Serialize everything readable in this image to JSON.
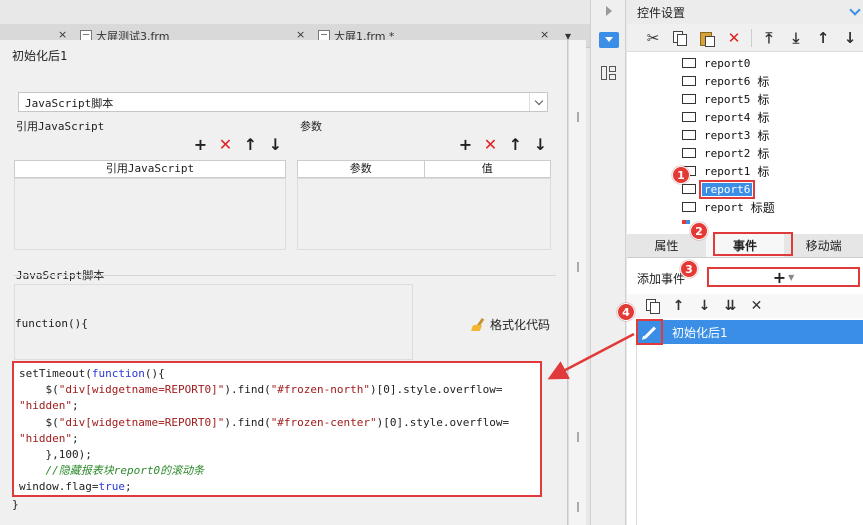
{
  "tabs": [
    {
      "label": "大屏测试3.frm",
      "close": "×"
    },
    {
      "label": "大屏1.frm *",
      "close": "×"
    }
  ],
  "dialog": {
    "title": "初始化后1",
    "script_type": "JavaScript脚本",
    "ref_js_label": "引用JavaScript",
    "params_label": "参数",
    "ref_js_col": "引用JavaScript",
    "param_col": "参数",
    "value_col": "值",
    "script_label": "JavaScript脚本",
    "fn_head": "function(){",
    "format_button": "格式化代码",
    "code_lines": [
      [
        {
          "t": "setTimeout(",
          "c": ""
        },
        {
          "t": "function",
          "c": "kw"
        },
        {
          "t": "(){",
          "c": ""
        }
      ],
      [
        {
          "t": "    $(",
          "c": ""
        },
        {
          "t": "\"div[widgetname=REPORT0]\"",
          "c": "str"
        },
        {
          "t": ").find(",
          "c": ""
        },
        {
          "t": "\"#frozen-north\"",
          "c": "str"
        },
        {
          "t": ")[0].style.overflow=",
          "c": ""
        }
      ],
      [
        {
          "t": "\"hidden\"",
          "c": "str"
        },
        {
          "t": ";",
          "c": ""
        }
      ],
      [
        {
          "t": "    $(",
          "c": ""
        },
        {
          "t": "\"div[widgetname=REPORT0]\"",
          "c": "str"
        },
        {
          "t": ").find(",
          "c": ""
        },
        {
          "t": "\"#frozen-center\"",
          "c": "str"
        },
        {
          "t": ")[0].style.overflow=",
          "c": ""
        }
      ],
      [
        {
          "t": "\"hidden\"",
          "c": "str"
        },
        {
          "t": ";",
          "c": ""
        }
      ],
      [
        {
          "t": "    },100);",
          "c": ""
        }
      ],
      [
        {
          "t": "    //隐藏报表块report0的滚动条",
          "c": "cmt"
        }
      ],
      [
        {
          "t": "window.flag=",
          "c": ""
        },
        {
          "t": "true",
          "c": "kw"
        },
        {
          "t": ";",
          "c": ""
        }
      ]
    ],
    "close_brace": "}"
  },
  "toolbar_icons": {
    "add": "+",
    "delete": "✕",
    "up": "🡑",
    "down": "🡓"
  },
  "right_panel": {
    "title": "控件设置",
    "tree_items": [
      {
        "label": "report0",
        "suffix": ""
      },
      {
        "label": "report6",
        "suffix": "标"
      },
      {
        "label": "report5",
        "suffix": "标"
      },
      {
        "label": "report4",
        "suffix": "标"
      },
      {
        "label": "report3",
        "suffix": "标"
      },
      {
        "label": "report2",
        "suffix": "标"
      },
      {
        "label": "report1",
        "suffix": "标"
      },
      {
        "label": "report6",
        "suffix": "",
        "selected": true
      },
      {
        "label": "report",
        "suffix": "标题"
      }
    ],
    "tabs": [
      "属性",
      "事件",
      "移动端"
    ],
    "active_tab": "事件",
    "add_event_label": "添加事件",
    "add_event_symbol": "+",
    "event_name": "初始化后1"
  },
  "badges": [
    "1",
    "2",
    "3",
    "4"
  ],
  "colors": {
    "accent": "#3a8ee6",
    "highlight": "#e03a3a",
    "badge": "#e53935"
  }
}
